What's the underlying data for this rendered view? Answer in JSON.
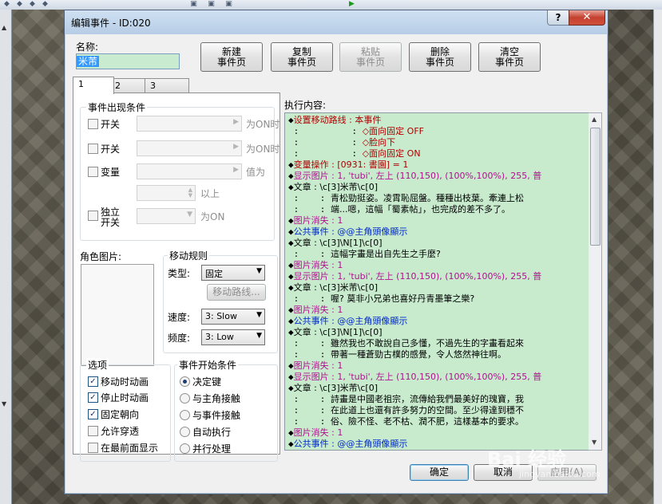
{
  "dialog": {
    "title": "编辑事件 - ID:020",
    "help": "?",
    "close": "✕"
  },
  "name": {
    "label": "名称:",
    "value": "米芾"
  },
  "page_buttons": {
    "new": [
      "新建",
      "事件页"
    ],
    "copy": [
      "复制",
      "事件页"
    ],
    "paste": [
      "粘贴",
      "事件页"
    ],
    "delete": [
      "删除",
      "事件页"
    ],
    "clear": [
      "清空",
      "事件页"
    ]
  },
  "tabs": [
    "1",
    "2",
    "3"
  ],
  "conditions": {
    "title": "事件出现条件",
    "switch1": "开关",
    "switch1_suffix": "为ON时",
    "switch2": "开关",
    "switch2_suffix": "为ON时",
    "variable": "变量",
    "variable_suffix": "值为",
    "variable_min_suffix": "以上",
    "self_switch_1": "独立",
    "self_switch_2": "开关",
    "self_switch_suffix": "为ON"
  },
  "graphic": {
    "title": "角色图片:"
  },
  "movement": {
    "title": "移动规则",
    "type_label": "类型:",
    "type_value": "固定",
    "route_button": "移动路线...",
    "speed_label": "速度:",
    "speed_value": "3: Slow",
    "freq_label": "频度:",
    "freq_value": "3: Low"
  },
  "options": {
    "title": "选项",
    "items": [
      {
        "label": "移动时动画",
        "checked": true
      },
      {
        "label": "停止时动画",
        "checked": true
      },
      {
        "label": "固定朝向",
        "checked": true
      },
      {
        "label": "允许穿透",
        "checked": false
      },
      {
        "label": "在最前面显示",
        "checked": false
      }
    ]
  },
  "trigger": {
    "title": "事件开始条件",
    "items": [
      {
        "label": "决定键",
        "selected": true
      },
      {
        "label": "与主角接触",
        "selected": false
      },
      {
        "label": "与事件接触",
        "selected": false
      },
      {
        "label": "自动执行",
        "selected": false
      },
      {
        "label": "并行处理",
        "selected": false
      }
    ]
  },
  "commands": {
    "label": "执行内容:",
    "lines": [
      {
        "prefix": "◆",
        "text": "设置移动路线 : 本事件",
        "color": "#b00000"
      },
      {
        "prefix": " :          : ",
        "text": "◇面向固定 OFF",
        "color": "#b00000"
      },
      {
        "prefix": " :          : ",
        "text": "◇脸向下",
        "color": "#b00000"
      },
      {
        "prefix": " :          : ",
        "text": "◇面向固定 ON",
        "color": "#b00000"
      },
      {
        "prefix": "◆",
        "text": "变量操作 : [0931: 書園] = 1",
        "color": "#b00000"
      },
      {
        "prefix": "◆",
        "text": "显示图片 : 1, 'tubi', 左上 (110,150), (100%,100%), 255, 普",
        "color": "#b0108e"
      },
      {
        "prefix": "◆",
        "text": "文章 : \\c[3]米芾\\c[0]",
        "color": "#000000"
      },
      {
        "prefix": " :    : ",
        "text": "青松勁挺姿。凌霄恥屈盤。種種出枝葉。牽連上松",
        "color": "#000000"
      },
      {
        "prefix": " :    : ",
        "text": "端...嗯，這幅「蜀素帖」，也完成的差不多了。",
        "color": "#000000"
      },
      {
        "prefix": "◆",
        "text": "图片消失 : 1",
        "color": "#b0108e"
      },
      {
        "prefix": "◆",
        "text": "公共事件 : @@主角頭像顯示",
        "color": "#0028c8"
      },
      {
        "prefix": "◆",
        "text": "文章 : \\c[3]\\N[1]\\c[0]",
        "color": "#000000"
      },
      {
        "prefix": " :    : ",
        "text": "這幅字畫是出自先生之手麼?",
        "color": "#000000"
      },
      {
        "prefix": "◆",
        "text": "图片消失 : 1",
        "color": "#b0108e"
      },
      {
        "prefix": "◆",
        "text": "显示图片 : 1, 'tubi', 左上 (110,150), (100%,100%), 255, 普",
        "color": "#b0108e"
      },
      {
        "prefix": "◆",
        "text": "文章 : \\c[3]米芾\\c[0]",
        "color": "#000000"
      },
      {
        "prefix": " :    : ",
        "text": "喔? 莫非小兄弟也喜好丹青墨筆之樂?",
        "color": "#000000"
      },
      {
        "prefix": "◆",
        "text": "图片消失 : 1",
        "color": "#b0108e"
      },
      {
        "prefix": "◆",
        "text": "公共事件 : @@主角頭像顯示",
        "color": "#0028c8"
      },
      {
        "prefix": "◆",
        "text": "文章 : \\c[3]\\N[1]\\c[0]",
        "color": "#000000"
      },
      {
        "prefix": " :    : ",
        "text": "雖然我也不敢說自己多懂，不過先生的字畫看起來",
        "color": "#000000"
      },
      {
        "prefix": " :    : ",
        "text": "帶著一種蒼勁古樸的感覺，令人悠然神往啊。",
        "color": "#000000"
      },
      {
        "prefix": "◆",
        "text": "图片消失 : 1",
        "color": "#b0108e"
      },
      {
        "prefix": "◆",
        "text": "显示图片 : 1, 'tubi', 左上 (110,150), (100%,100%), 255, 普",
        "color": "#b0108e"
      },
      {
        "prefix": "◆",
        "text": "文章 : \\c[3]米芾\\c[0]",
        "color": "#000000"
      },
      {
        "prefix": " :    : ",
        "text": "詩畫是中國老祖宗，流傳給我們最美好的瑰寶，我",
        "color": "#000000"
      },
      {
        "prefix": " :    : ",
        "text": "在此道上也還有許多努力的空間。至少得達到穩不",
        "color": "#000000"
      },
      {
        "prefix": " :    : ",
        "text": "俗、險不怪、老不枯、潤不肥，這樣基本的要求。",
        "color": "#000000"
      },
      {
        "prefix": "◆",
        "text": "图片消失 : 1",
        "color": "#b0108e"
      },
      {
        "prefix": "◆",
        "text": "公共事件 : @@主角頭像顯示",
        "color": "#0028c8"
      }
    ]
  },
  "footer": {
    "ok": "确定",
    "cancel": "取消",
    "apply": "应用(A)"
  },
  "watermark": {
    "line1": "Bai 经验",
    "line2": "jingyan.baidu.com"
  }
}
